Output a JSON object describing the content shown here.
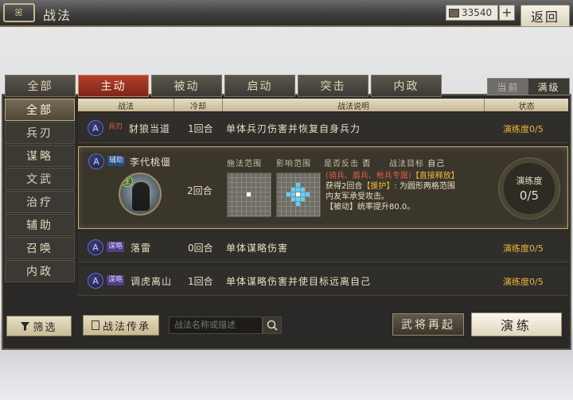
{
  "header": {
    "logo_text": "ꕤ",
    "title": "战法",
    "currency_value": "33540",
    "plus_label": "+",
    "back_label": "返回"
  },
  "tabs": [
    {
      "label": "全部",
      "active": false
    },
    {
      "label": "主动",
      "active": true
    },
    {
      "label": "被动",
      "active": false
    },
    {
      "label": "启动",
      "active": false
    },
    {
      "label": "突击",
      "active": false
    },
    {
      "label": "内政",
      "active": false
    }
  ],
  "level_toggle": {
    "current": "当前",
    "max": "满级",
    "selected": "满级"
  },
  "sidebar": {
    "items": [
      {
        "label": "全部",
        "active": true
      },
      {
        "label": "兵刃",
        "active": false
      },
      {
        "label": "谋略",
        "active": false
      },
      {
        "label": "文武",
        "active": false
      },
      {
        "label": "治疗",
        "active": false
      },
      {
        "label": "辅助",
        "active": false
      },
      {
        "label": "召唤",
        "active": false
      },
      {
        "label": "内政",
        "active": false
      }
    ],
    "filter_label": "筛选",
    "filter_icon": "funnel-icon"
  },
  "table": {
    "columns": [
      "战法",
      "冷却",
      "战法说明",
      "状态"
    ],
    "rows": [
      {
        "icon": "A",
        "type": "兵刃",
        "type_color": "#f05a4a",
        "name": "豺狼当道",
        "cooldown": "1回合",
        "desc": "单体兵刃伤害并恢复自身兵力",
        "status": "演练度0/5"
      },
      {
        "icon": "A",
        "type": "谋略",
        "type_color": "#d7c7ff",
        "name": "落雷",
        "cooldown": "0回合",
        "desc": "单体谋略伤害",
        "status": "演练度0/5"
      },
      {
        "icon": "A",
        "type": "谋略",
        "type_color": "#d7c7ff",
        "name": "调虎离山",
        "cooldown": "1回合",
        "desc": "单体谋略伤害并使目标远离自己",
        "status": "演练度0/5"
      }
    ]
  },
  "expanded": {
    "icon": "A",
    "type": "辅助",
    "name": "李代桃僵",
    "cooldown": "2回合",
    "medal": "王",
    "cast_range_label": "施法范围",
    "effect_range_label": "影响范围",
    "counter_label": "是否反击",
    "counter_value": "否",
    "target_label": "战法目标",
    "target_value": "自己",
    "effect_line1": "(骑兵、盾兵、枪兵专属)",
    "effect_line1b": "【直接释放】",
    "effect_line2a": "获得2回合",
    "effect_line2b": "【援护】",
    "effect_line2c": ": 为圆形两格范围",
    "effect_line3": "内友军承受攻击。",
    "effect_line4": "【被动】统率提升80.0。",
    "progress_label": "演练度",
    "progress_value": "0/5",
    "progress_fraction": 0.0
  },
  "bottom": {
    "inherit_label": "战法传承",
    "search_placeholder": "战法名称或描述",
    "reroll_label": "武将再起",
    "train_label": "演练"
  },
  "colors": {
    "accent_red": "#b2412f",
    "status_gold": "#efb63f",
    "panel_dark": "#2a2927"
  }
}
